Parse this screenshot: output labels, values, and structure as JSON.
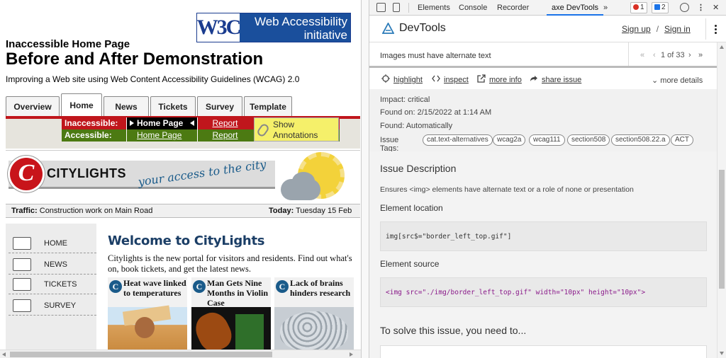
{
  "webpage": {
    "wai_logo": {
      "w3c": "W3C",
      "line1": "Web Accessibility",
      "line2": "initiative"
    },
    "title_small": "Inaccessible Home Page",
    "title_big": "Before and After Demonstration",
    "subtitle": "Improving a Web site using Web Content Accessibility Guidelines (WCAG) 2.0",
    "tabs": [
      {
        "label": "Overview",
        "active": false
      },
      {
        "label": "Home",
        "active": true
      },
      {
        "label": "News",
        "active": false
      },
      {
        "label": "Tickets",
        "active": false
      },
      {
        "label": "Survey",
        "active": false
      },
      {
        "label": "Template",
        "active": false
      }
    ],
    "demo": {
      "inaccessible_label": "Inaccessible:",
      "inaccessible_page": "Home Page",
      "inaccessible_report": "Report",
      "accessible_label": "Accessible:",
      "accessible_page": "Home Page",
      "accessible_report": "Report",
      "annotations": "Show Annotations"
    },
    "banner": {
      "logo_letter": "C",
      "name": "CITYLIGHTS",
      "tagline": "your access to the city"
    },
    "traffic": {
      "label": "Traffic:",
      "text": "Construction work on Main Road",
      "today_label": "Today:",
      "today_text": "Tuesday 15 Feb"
    },
    "nav": [
      "HOME",
      "NEWS",
      "TICKETS",
      "SURVEY"
    ],
    "welcome_title": "Welcome to CityLights",
    "intro": "Citylights is the new portal for visitors and residents. Find out what's on, book tickets, and get the latest news.",
    "news": [
      {
        "title": "Heat wave linked to temperatures"
      },
      {
        "title": "Man Gets Nine Months in Violin Case"
      },
      {
        "title": "Lack of brains hinders research"
      }
    ]
  },
  "devtools": {
    "tabs": [
      "Elements",
      "Console",
      "Recorder",
      "axe DevTools"
    ],
    "more_tabs": "»",
    "errors_count": "1",
    "messages_count": "2",
    "axe": {
      "title": "DevTools",
      "sign_up": "Sign up",
      "slash": "/",
      "sign_in": "Sign in",
      "issue_title": "Images must have alternate text",
      "pager": {
        "first": "«",
        "prev": "‹",
        "text": "1 of 33",
        "next": "›",
        "last": "»"
      },
      "actions": {
        "highlight": "highlight",
        "inspect": "inspect",
        "more_info": "more info",
        "share": "share issue",
        "details": "more details"
      },
      "meta": {
        "impact": "Impact: critical",
        "found_on": "Found on: 2/15/2022 at 1:14 AM",
        "found": "Found: Automatically",
        "tags_label": "Issue Tags:",
        "tags": [
          "cat.text-alternatives",
          "wcag2a",
          "wcag111",
          "section508",
          "section508.22.a",
          "ACT"
        ]
      },
      "description_title": "Issue Description",
      "description": "Ensures <img> elements have alternate text or a role of none or presentation",
      "location_title": "Element location",
      "location_code": "img[src$=\"border_left_top.gif\"]",
      "source_title": "Element source",
      "source_code": "<img src=\"./img/border_left_top.gif\" width=\"10px\" height=\"10px\">",
      "solve_title": "To solve this issue, you need to..."
    }
  }
}
